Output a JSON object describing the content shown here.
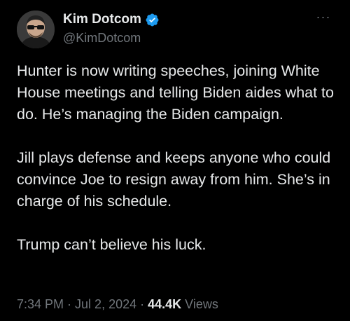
{
  "colors": {
    "background": "#000000",
    "text_primary": "#e7e9ea",
    "text_secondary": "#71767b",
    "verified_badge": "#1d9bf0"
  },
  "author": {
    "display_name": "Kim Dotcom",
    "handle": "@KimDotcom",
    "verified": true,
    "avatar_icon": "profile-photo"
  },
  "more_menu": {
    "icon": "more-horizontal-icon",
    "label": "···"
  },
  "tweet": {
    "paragraphs": [
      "Hunter is now writing speeches, joining White House meetings and telling Biden aides what to do. He’s managing the Biden campaign.",
      "Jill plays defense and keeps anyone who could convince Joe to resign away from him. She’s in charge of his schedule.",
      "Trump can’t believe his luck."
    ]
  },
  "meta": {
    "time": "7:34 PM",
    "separator": "·",
    "date": "Jul 2, 2024",
    "views_count": "44.4K",
    "views_label": "Views"
  }
}
